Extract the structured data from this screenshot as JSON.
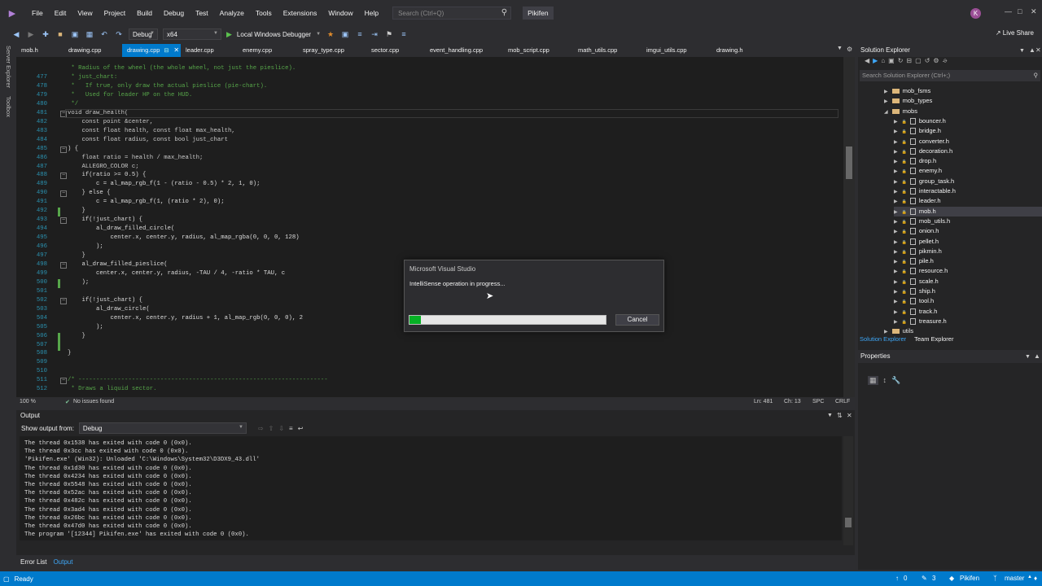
{
  "titlebar": {
    "menus": [
      "File",
      "Edit",
      "View",
      "Project",
      "Build",
      "Debug",
      "Test",
      "Analyze",
      "Tools",
      "Extensions",
      "Window",
      "Help"
    ],
    "search_placeholder": "Search (Ctrl+Q)",
    "solution": "Pikifen",
    "avatar": "K"
  },
  "toolbar": {
    "config": "Debug",
    "platform": "x64",
    "debugger": "Local Windows Debugger",
    "live_share": "Live Share"
  },
  "side": {
    "server_explorer": "Server Explorer",
    "toolbox": "Toolbox"
  },
  "tabs": [
    {
      "label": "mob.h",
      "active": false
    },
    {
      "label": "drawing.cpp",
      "active": false
    },
    {
      "label": "drawing.cpp",
      "active": true
    },
    {
      "label": "leader.cpp",
      "active": false
    },
    {
      "label": "enemy.cpp",
      "active": false
    },
    {
      "label": "spray_type.cpp",
      "active": false
    },
    {
      "label": "sector.cpp",
      "active": false
    },
    {
      "label": "event_handling.cpp",
      "active": false
    },
    {
      "label": "mob_script.cpp",
      "active": false
    },
    {
      "label": "math_utils.cpp",
      "active": false
    },
    {
      "label": "imgui_utils.cpp",
      "active": false
    },
    {
      "label": "drawing.h",
      "active": false
    }
  ],
  "code": [
    {
      "n": "477",
      "t": " * just_chart:"
    },
    {
      "n": "478",
      "t": " *   If true, only draw the actual pieslice (pie-chart)."
    },
    {
      "n": "479",
      "t": " *   Used for leader HP on the HUD."
    },
    {
      "n": "480",
      "t": " */"
    },
    {
      "n": "481",
      "t": "void draw_health("
    },
    {
      "n": "482",
      "t": "    const point &center,"
    },
    {
      "n": "483",
      "t": "    const float health, const float max_health,"
    },
    {
      "n": "484",
      "t": "    const float radius, const bool just_chart"
    },
    {
      "n": "485",
      "t": ") {"
    },
    {
      "n": "486",
      "t": "    float ratio = health / max_health;"
    },
    {
      "n": "487",
      "t": "    ALLEGRO_COLOR c;"
    },
    {
      "n": "488",
      "t": "    if(ratio >= 0.5) {"
    },
    {
      "n": "489",
      "t": "        c = al_map_rgb_f(1 - (ratio - 0.5) * 2, 1, 0);"
    },
    {
      "n": "490",
      "t": "    } else {"
    },
    {
      "n": "491",
      "t": "        c = al_map_rgb_f(1, (ratio * 2), 0);"
    },
    {
      "n": "492",
      "t": "    }"
    },
    {
      "n": "493",
      "t": "    if(!just_chart) {"
    },
    {
      "n": "494",
      "t": "        al_draw_filled_circle("
    },
    {
      "n": "495",
      "t": "            center.x, center.y, radius, al_map_rgba(0, 0, 0, 128)"
    },
    {
      "n": "496",
      "t": "        );"
    },
    {
      "n": "497",
      "t": "    }"
    },
    {
      "n": "498",
      "t": "    al_draw_filled_pieslice("
    },
    {
      "n": "499",
      "t": "        center.x, center.y, radius, -TAU / 4, -ratio * TAU, c"
    },
    {
      "n": "500",
      "t": "    );"
    },
    {
      "n": "501",
      "t": ""
    },
    {
      "n": "502",
      "t": "    if(!just_chart) {"
    },
    {
      "n": "503",
      "t": "        al_draw_circle("
    },
    {
      "n": "504",
      "t": "            center.x, center.y, radius + 1, al_map_rgb(0, 0, 0), 2"
    },
    {
      "n": "505",
      "t": "        );"
    },
    {
      "n": "506",
      "t": "    }"
    },
    {
      "n": "507",
      "t": ""
    },
    {
      "n": "508",
      "t": "}"
    },
    {
      "n": "509",
      "t": ""
    },
    {
      "n": "510",
      "t": ""
    },
    {
      "n": "511",
      "t": "/* ----------------------------------------------------------------------"
    },
    {
      "n": "512",
      "t": " * Draws a liquid sector."
    }
  ],
  "code_top_partial": " * Radius of the wheel (the whole wheel, not just the pieslice).",
  "editor_status": {
    "zoom": "100 %",
    "issues": "No issues found",
    "ln": "Ln: 481",
    "ch": "Ch: 13",
    "spc": "SPC",
    "crlf": "CRLF"
  },
  "output": {
    "title": "Output",
    "show_from_label": "Show output from:",
    "show_from_value": "Debug",
    "lines": [
      "The thread 0x1538 has exited with code 0 (0x0).",
      "The thread 0x3cc has exited with code 0 (0x0).",
      "'Pikifen.exe' (Win32): Unloaded 'C:\\Windows\\System32\\D3DX9_43.dll'",
      "The thread 0x1d30 has exited with code 0 (0x0).",
      "The thread 0x4234 has exited with code 0 (0x0).",
      "The thread 0x5548 has exited with code 0 (0x0).",
      "The thread 0x52ac has exited with code 0 (0x0).",
      "The thread 0x482c has exited with code 0 (0x0).",
      "The thread 0x3ad4 has exited with code 0 (0x0).",
      "The thread 0x26bc has exited with code 0 (0x0).",
      "The thread 0x47d0 has exited with code 0 (0x0).",
      "The program '[12344] Pikifen.exe' has exited with code 0 (0x0)."
    ]
  },
  "bottom_tabs": {
    "error_list": "Error List",
    "output": "Output"
  },
  "solution_explorer": {
    "title": "Solution Explorer",
    "search_placeholder": "Search Solution Explorer (Ctrl+;)",
    "folders": [
      "mob_fsms",
      "mob_types",
      "mobs"
    ],
    "files": [
      "bouncer.h",
      "bridge.h",
      "converter.h",
      "decoration.h",
      "drop.h",
      "enemy.h",
      "group_task.h",
      "interactable.h",
      "leader.h",
      "mob.h",
      "mob_utils.h",
      "onion.h",
      "pellet.h",
      "pikmin.h",
      "pile.h",
      "resource.h",
      "scale.h",
      "ship.h",
      "tool.h",
      "track.h",
      "treasure.h"
    ],
    "last_folder": "utils",
    "tab_solution": "Solution Explorer",
    "tab_team": "Team Explorer"
  },
  "properties": {
    "title": "Properties"
  },
  "dialog": {
    "title": "Microsoft Visual Studio",
    "message": "IntelliSense operation in progress...",
    "progress": 0.06,
    "cancel": "Cancel"
  },
  "statusbar": {
    "ready": "Ready",
    "up": "0",
    "pencil": "3",
    "repo": "Pikifen",
    "branch": "master"
  },
  "colors": {
    "accent": "#007acc",
    "progress": "#06b025"
  }
}
